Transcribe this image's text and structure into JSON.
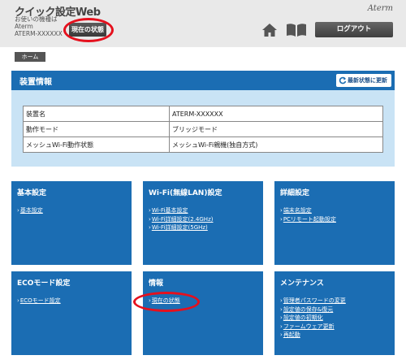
{
  "header": {
    "app_title": "クイック設定Web",
    "device_intro": "お使いの機種は",
    "device_brand": "Aterm",
    "device_model": "ATERM-XXXXXX",
    "status_button_label": "現在の状態",
    "brand_logo": "Aterm",
    "logout_label": "ログアウト",
    "home_icon": "home-icon",
    "manual_icon": "book-icon"
  },
  "breadcrumb": {
    "home": "ホーム"
  },
  "device_panel": {
    "title": "装置情報",
    "refresh_label": "最新状態に更新",
    "rows": [
      {
        "key": "装置名",
        "value": "ATERM-XXXXXX"
      },
      {
        "key": "動作モード",
        "value": "ブリッジモード"
      },
      {
        "key": "メッシュWi-Fi動作状態",
        "value": "メッシュWi-Fi親機(独自方式)"
      }
    ]
  },
  "tiles": [
    {
      "title": "基本設定",
      "links": [
        "基本設定"
      ]
    },
    {
      "title": "Wi-Fi(無線LAN)設定",
      "links": [
        "Wi-Fi基本設定",
        "Wi-Fi詳細設定(2.4GHz)",
        "Wi-Fi詳細設定(5GHz)"
      ]
    },
    {
      "title": "詳細設定",
      "links": [
        "端末名設定",
        "PCリモート起動設定"
      ]
    },
    {
      "title": "ECOモード設定",
      "links": [
        "ECOモード設定"
      ]
    },
    {
      "title": "情報",
      "links": [
        "現在の状態"
      ]
    },
    {
      "title": "メンテナンス",
      "links": [
        "管理者パスワードの変更",
        "設定値の保存&復元",
        "設定値の初期化",
        "ファームウェア更新",
        "再起動"
      ]
    }
  ],
  "colors": {
    "accent": "#1b6db3",
    "panel_bg": "#c9e3f5",
    "highlight": "#e5101d"
  }
}
